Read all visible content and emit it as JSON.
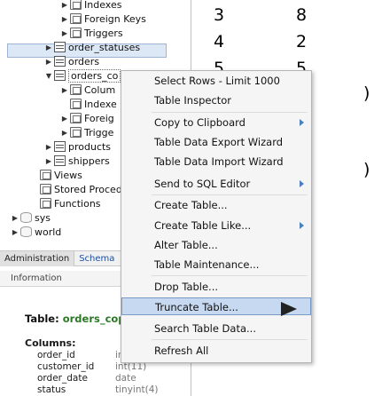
{
  "navigator": {
    "tree": [
      {
        "label": "Indexes",
        "icon": "folder-icon"
      },
      {
        "label": "Foreign Keys",
        "icon": "folder-icon"
      },
      {
        "label": "Triggers",
        "icon": "folder-icon"
      },
      {
        "label": "order_statuses",
        "icon": "table-icon"
      },
      {
        "label": "orders",
        "icon": "table-icon"
      },
      {
        "label": "orders_co",
        "icon": "table-icon"
      },
      {
        "label": "Colum",
        "icon": "folder-icon"
      },
      {
        "label": "Indexe",
        "icon": "folder-icon"
      },
      {
        "label": "Foreig",
        "icon": "folder-icon"
      },
      {
        "label": "Trigge",
        "icon": "folder-icon"
      },
      {
        "label": "products",
        "icon": "table-icon"
      },
      {
        "label": "shippers",
        "icon": "table-icon"
      },
      {
        "label": "Views",
        "icon": "folder-icon"
      },
      {
        "label": "Stored Proced",
        "icon": "folder-icon"
      },
      {
        "label": "Functions",
        "icon": "folder-icon"
      },
      {
        "label": "sys",
        "icon": "database-icon"
      },
      {
        "label": "world",
        "icon": "database-icon"
      }
    ],
    "tabs": [
      "Administration",
      "Schema"
    ],
    "info_header": "Information"
  },
  "info": {
    "title_prefix": "Table:",
    "table_name": "orders_cop",
    "columns_label": "Columns:",
    "columns": [
      {
        "name": "order_id",
        "type": "ir"
      },
      {
        "name": "customer_id",
        "type": "int(11)"
      },
      {
        "name": "order_date",
        "type": "date"
      },
      {
        "name": "status",
        "type": "tinyint(4)"
      }
    ]
  },
  "grid": {
    "rows": [
      [
        "3",
        "8"
      ],
      [
        "4",
        "2"
      ],
      [
        "5",
        "5"
      ]
    ],
    "edge_glyphs": [
      ")",
      ")"
    ]
  },
  "context_menu": {
    "items": [
      {
        "label": "Select Rows - Limit 1000",
        "submenu": false
      },
      {
        "label": "Table Inspector",
        "submenu": false
      },
      {
        "label": "Copy to Clipboard",
        "submenu": true
      },
      {
        "label": "Table Data Export Wizard",
        "submenu": false
      },
      {
        "label": "Table Data Import Wizard",
        "submenu": false
      },
      {
        "label": "Send to SQL Editor",
        "submenu": true
      },
      {
        "label": "Create Table...",
        "submenu": false
      },
      {
        "label": "Create Table Like...",
        "submenu": true
      },
      {
        "label": "Alter Table...",
        "submenu": false
      },
      {
        "label": "Table Maintenance...",
        "submenu": false
      },
      {
        "label": "Drop Table...",
        "submenu": false
      },
      {
        "label": "Truncate Table...",
        "submenu": false,
        "highlighted": true
      },
      {
        "label": "Search Table Data...",
        "submenu": false
      },
      {
        "label": "Refresh All",
        "submenu": false
      }
    ]
  }
}
